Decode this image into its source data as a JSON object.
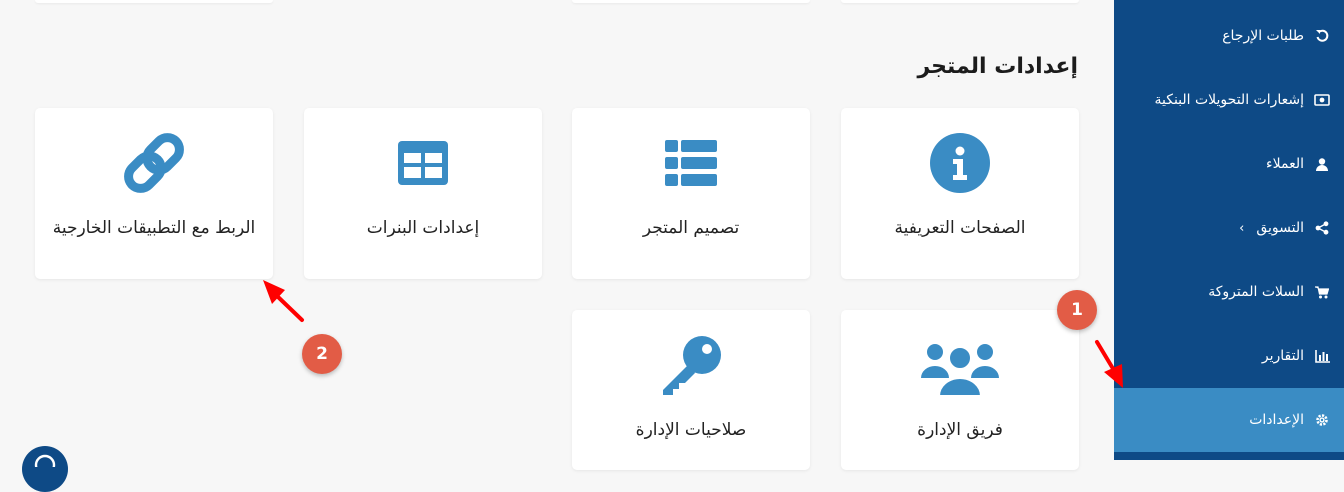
{
  "sidebar": {
    "items": [
      {
        "label": "طلبات الإرجاع",
        "icon": "undo-icon"
      },
      {
        "label": "إشعارات التحويلات البنكية",
        "icon": "money-icon"
      },
      {
        "label": "العملاء",
        "icon": "user-icon"
      },
      {
        "label": "التسويق",
        "icon": "share-icon",
        "chevron": "‹"
      },
      {
        "label": "السلات المتروكة",
        "icon": "cart-icon"
      },
      {
        "label": "التقارير",
        "icon": "bar-chart-icon"
      },
      {
        "label": "الإعدادات",
        "icon": "gear-icon",
        "active": true
      }
    ]
  },
  "main": {
    "section_title": "إعدادات المتجر",
    "cards": [
      {
        "label": "الصفحات التعريفية",
        "icon": "info-icon"
      },
      {
        "label": "تصميم المتجر",
        "icon": "list-icon"
      },
      {
        "label": "إعدادات البنرات",
        "icon": "table-icon"
      },
      {
        "label": "الربط مع التطبيقات الخارجية",
        "icon": "link-icon"
      },
      {
        "label": "فريق الإدارة",
        "icon": "users-icon"
      },
      {
        "label": "صلاحيات الإدارة",
        "icon": "key-icon"
      }
    ]
  },
  "annotations": {
    "marker_1": "1",
    "marker_2": "2"
  },
  "colors": {
    "sidebar_bg": "#0e4a86",
    "sidebar_active": "#3a8cc4",
    "icon_blue": "#3a8cc4",
    "marker_red": "#e25c46",
    "arrow_red": "#ff0000"
  }
}
